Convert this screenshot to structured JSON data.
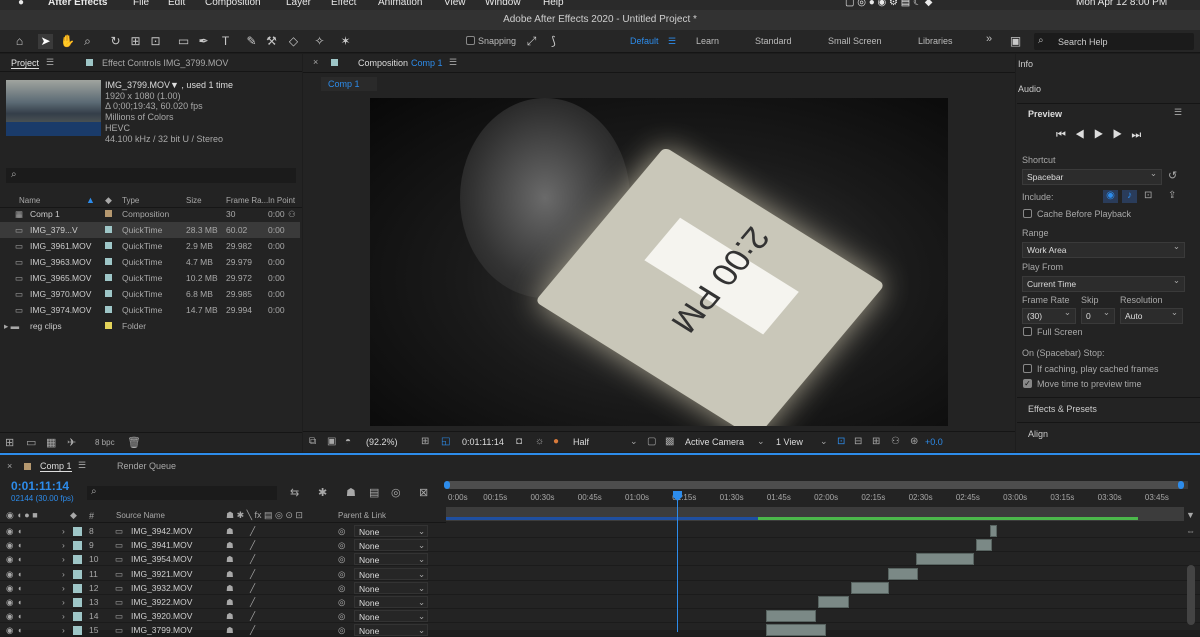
{
  "menubar": {
    "apple": "",
    "app": "After Effects",
    "items": [
      "File",
      "Edit",
      "Composition",
      "Layer",
      "Effect",
      "Animation",
      "View",
      "Window",
      "Help"
    ],
    "clock": "Mon Apr 12  8:00 PM"
  },
  "window_title": "Adobe After Effects 2020 - Untitled Project *",
  "toolbar": {
    "snapping": "Snapping",
    "workspaces": [
      "Default",
      "Learn",
      "Standard",
      "Small Screen",
      "Libraries"
    ],
    "more": "»",
    "search_placeholder": "Search Help"
  },
  "project": {
    "tab_project": "Project",
    "tab_effect": "Effect Controls IMG_3799.MOV",
    "selected_name": "IMG_3799.MOV▼ , used 1 time",
    "info_lines": [
      "1920 x 1080 (1.00)",
      "Δ 0;00;19:43, 60.020 fps",
      "Millions of Colors",
      "HEVC",
      "44.100 kHz / 32 bit U / Stereo"
    ],
    "search_icon": "⌕",
    "columns": [
      "Name",
      "Type",
      "Size",
      "Frame Ra...",
      "In Point"
    ],
    "items": [
      {
        "name": "Comp 1",
        "type": "Composition",
        "size": "",
        "fps": "30",
        "in": "0:00",
        "color": "#b5986f"
      },
      {
        "name": "IMG_379...V",
        "type": "QuickTime",
        "size": "28.3 MB",
        "fps": "60.02",
        "in": "0:00",
        "color": "#9ec6c7"
      },
      {
        "name": "IMG_3961.MOV",
        "type": "QuickTime",
        "size": "2.9 MB",
        "fps": "29.982",
        "in": "0:00",
        "color": "#9ec6c7"
      },
      {
        "name": "IMG_3963.MOV",
        "type": "QuickTime",
        "size": "4.7 MB",
        "fps": "29.979",
        "in": "0:00",
        "color": "#9ec6c7"
      },
      {
        "name": "IMG_3965.MOV",
        "type": "QuickTime",
        "size": "10.2 MB",
        "fps": "29.972",
        "in": "0:00",
        "color": "#9ec6c7"
      },
      {
        "name": "IMG_3970.MOV",
        "type": "QuickTime",
        "size": "6.8 MB",
        "fps": "29.985",
        "in": "0:00",
        "color": "#9ec6c7"
      },
      {
        "name": "IMG_3974.MOV",
        "type": "QuickTime",
        "size": "14.7 MB",
        "fps": "29.994",
        "in": "0:00",
        "color": "#9ec6c7"
      },
      {
        "name": "reg clips",
        "type": "Folder",
        "size": "",
        "fps": "",
        "in": "",
        "color": "#e3d35a"
      }
    ],
    "bpc": "8 bpc"
  },
  "composition": {
    "tab_label": "Composition",
    "tab_comp": "Comp 1",
    "sub_tab": "Comp 1",
    "tablet_text": "2:00 PM",
    "footer": {
      "zoom": "(92.2%)",
      "timecode": "0:01:11:14",
      "resolution": "Half",
      "camera": "Active Camera",
      "view": "1 View",
      "exposure": "+0.0"
    }
  },
  "right_panel": {
    "info": "Info",
    "audio": "Audio",
    "preview": "Preview",
    "shortcut": "Shortcut",
    "shortcut_val": "Spacebar",
    "include": "Include:",
    "cache_before": "Cache Before Playback",
    "range": "Range",
    "range_val": "Work Area",
    "play_from": "Play From",
    "play_from_val": "Current Time",
    "frame_rate": "Frame Rate",
    "skip": "Skip",
    "resolution": "Resolution",
    "fr_val": "(30)",
    "skip_val": "0",
    "res_val": "Auto",
    "full_screen": "Full Screen",
    "on_stop": "On (Spacebar) Stop:",
    "if_caching": "If caching, play cached frames",
    "move_time": "Move time to preview time",
    "effects": "Effects & Presets",
    "align": "Align"
  },
  "timeline": {
    "tab_comp": "Comp 1",
    "tab_render": "Render Queue",
    "timecode": "0:01:11:14",
    "frames": "02144 (30.00 fps)",
    "col_hash": "#",
    "col_source": "Source Name",
    "col_parent": "Parent & Link",
    "ruler": [
      "0:00s",
      "00:15s",
      "00:30s",
      "00:45s",
      "01:00s",
      "01:15s",
      "01:30s",
      "01:45s",
      "02:00s",
      "02:15s",
      "02:30s",
      "02:45s",
      "03:00s",
      "03:15s",
      "03:30s",
      "03:45s"
    ],
    "layers": [
      {
        "num": "8",
        "name": "IMG_3942.MOV",
        "parent": "None"
      },
      {
        "num": "9",
        "name": "IMG_3941.MOV",
        "parent": "None"
      },
      {
        "num": "10",
        "name": "IMG_3954.MOV",
        "parent": "None"
      },
      {
        "num": "11",
        "name": "IMG_3921.MOV",
        "parent": "None"
      },
      {
        "num": "12",
        "name": "IMG_3932.MOV",
        "parent": "None"
      },
      {
        "num": "13",
        "name": "IMG_3922.MOV",
        "parent": "None"
      },
      {
        "num": "14",
        "name": "IMG_3920.MOV",
        "parent": "None"
      },
      {
        "num": "15",
        "name": "IMG_3799.MOV",
        "parent": "None"
      }
    ]
  },
  "colors": {
    "accent": "#2d8ceb",
    "label_green": "#4bb84b",
    "clip": "#7b8986"
  }
}
